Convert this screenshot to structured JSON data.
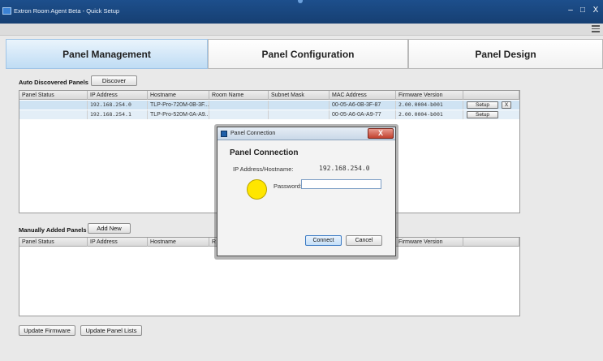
{
  "window": {
    "title": "Extron Room Agent Beta - Quick Setup",
    "minimize_glyph": "–",
    "maximize_glyph": "□",
    "close_glyph": "X"
  },
  "tabs": [
    {
      "label": "Panel Management",
      "active": true
    },
    {
      "label": "Panel Configuration",
      "active": false
    },
    {
      "label": "Panel Design",
      "active": false
    }
  ],
  "auto": {
    "label": "Auto Discovered Panels",
    "discover_label": "Discover",
    "columns": [
      "Panel Status",
      "IP Address",
      "Hostname",
      "Room Name",
      "Subnet Mask",
      "MAC Address",
      "Firmware Version",
      ""
    ],
    "rows": [
      {
        "status": "",
        "ip": "192.168.254.0",
        "hostname": "TLP-Pro-720M-0B-3F...",
        "room": "",
        "subnet": "",
        "mac": "00-05-A6-0B-3F-87",
        "firmware": "2.00.0004-b001",
        "setup": "Setup",
        "remove": "X"
      },
      {
        "status": "",
        "ip": "192.168.254.1",
        "hostname": "TLP-Pro-520M-0A-A9...",
        "room": "",
        "subnet": "",
        "mac": "00-05-A6-0A-A9-77",
        "firmware": "2.00.0004-b001",
        "setup": "Setup"
      }
    ]
  },
  "manual": {
    "label": "Manually Added Panels",
    "add_label": "Add New",
    "columns": [
      "Panel Status",
      "IP Address",
      "Hostname",
      "R",
      "Firmware Version",
      ""
    ]
  },
  "footer": {
    "update_firmware": "Update Firmware",
    "update_panel_lists": "Update Panel Lists"
  },
  "dialog": {
    "title": "Panel Connection",
    "close": "X",
    "heading": "Panel Connection",
    "ip_label": "IP Address/Hostname:",
    "ip_value": "192.168.254.0",
    "password_label": "Password:",
    "password_value": "",
    "connect": "Connect",
    "cancel": "Cancel"
  },
  "colors": {
    "titlebar": "#1d4f8c",
    "active_tab": "#bfdcf4",
    "selected_row": "#cfe3f3",
    "cursor_highlight": "#ffe600",
    "dialog_close": "#c2412f"
  }
}
